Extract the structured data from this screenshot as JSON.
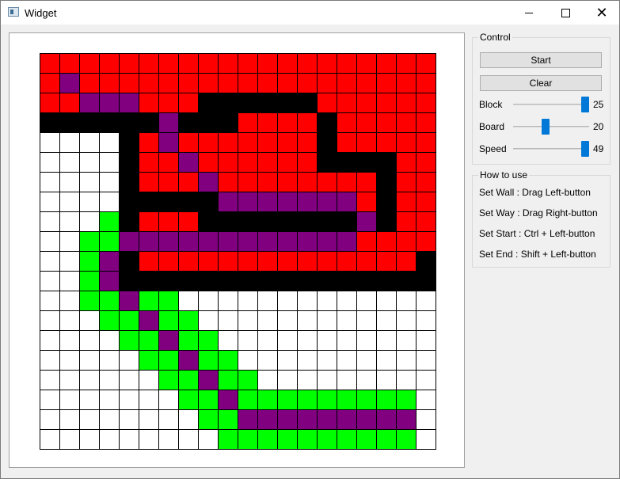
{
  "window": {
    "title": "Widget"
  },
  "control": {
    "group_title": "Control",
    "start_label": "Start",
    "clear_label": "Clear",
    "sliders": [
      {
        "label": "Block",
        "value": "25",
        "fraction": 1.0
      },
      {
        "label": "Board",
        "value": "20",
        "fraction": 0.42
      },
      {
        "label": "Speed",
        "value": "49",
        "fraction": 1.0
      }
    ]
  },
  "howto": {
    "group_title": "How to use",
    "lines": [
      "Set Wall : Drag Left-button",
      "Set Way : Drag Right-button",
      "Set Start : Ctrl + Left-button",
      "Set End : Shift + Left-button"
    ]
  },
  "board": {
    "cols": 20,
    "rows": 20,
    "colors": {
      "R": "#ff0000",
      "P": "#800080",
      "K": "#000000",
      "G": "#00ff00",
      "W": "#ffffff"
    },
    "grid_line_color": "#000000",
    "cells": [
      "RRRRRRRRRRRRRRRRRRRR",
      "RPRRRRRRRRRRRRRRRRRR",
      "RRPPPRRRKKKKKKRRRRRR",
      "KKKKKKPKKKRRRRKRRRRR",
      "WWWWKRPRRRRRRRKRRRRR",
      "WWWWKRRPRRRRRRKKKKRR",
      "WWWWKRRRPRRRRRRRRKRR",
      "WWWWKKKKKPPPPPPPRKRR",
      "WWWGKRRRKKKKKKKKPKRR",
      "WWGGPPPPPPPPPPPPRRRR",
      "WWGPKRRRRRRRRRRRRRRK",
      "WWGPKKKKKKKKKKKKKKKK",
      "WWGGPGGWWWWWWWWWWWWW",
      "WWWGGPGGWWWWWWWWWWWW",
      "WWWWGGPGGWWWWWWWWWWW",
      "WWWWWGGPGGWWWWWWWWWW",
      "WWWWWWGGPGGWWWWWWWWW",
      "WWWWWWWGGPGGGGGGGGGW",
      "WWWWWWWWGGPPPPPPPPPW",
      "WWWWWWWWWGGGGGGGGGGW"
    ]
  }
}
